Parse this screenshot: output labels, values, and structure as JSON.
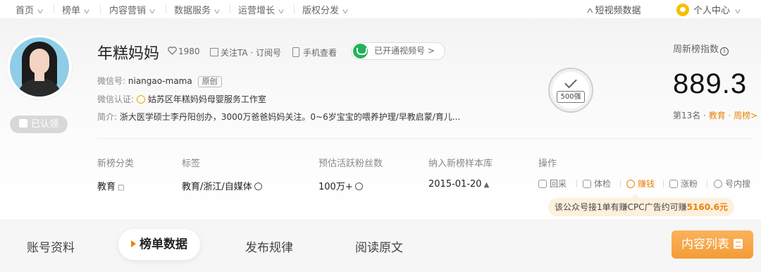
{
  "topnav": {
    "items": [
      {
        "label": "首页"
      },
      {
        "label": "榜单"
      },
      {
        "label": "内容营销"
      },
      {
        "label": "数据服务"
      },
      {
        "label": "运营增长"
      },
      {
        "label": "版权分发"
      }
    ],
    "short_video": "短视频数据",
    "personal_center": "个人中心"
  },
  "account": {
    "name": "年糕妈妈",
    "likes": "1980",
    "follow_label": "关注TA · 订阅号",
    "phone_label": "手机查看",
    "video_channel_label": "已开通视频号 >",
    "wechat_id_label": "微信号:",
    "wechat_id": "niangao-mama",
    "original_tag": "原创",
    "cert_label": "微信认证:",
    "cert_value": "姑苏区年糕妈妈母婴服务工作室",
    "intro_label": "简介:",
    "intro_value": "浙大医学硕士李丹阳创办，3000万爸爸妈妈关注。0~6岁宝宝的喂养护理/早教启蒙/育儿...",
    "claimed_label": "已认领"
  },
  "badge": {
    "label": "500强"
  },
  "index": {
    "title": "周新榜指数",
    "value": "889.3",
    "rank_prefix": "第13名 · ",
    "rank_link": "教育 · 周榜>"
  },
  "details": {
    "category_h": "新榜分类",
    "category_v": "教育",
    "tags_h": "标签",
    "tags_v": "教育/浙江/自媒体",
    "fans_h": "预估活跃粉丝数",
    "fans_v": "100万+",
    "since_h": "纳入新榜样本库",
    "since_v": "2015-01-20",
    "ops_h": "操作"
  },
  "ops": [
    {
      "label": "回采"
    },
    {
      "label": "体检"
    },
    {
      "label": "赚钱"
    },
    {
      "label": "涨粉"
    },
    {
      "label": "号内搜"
    }
  ],
  "earn_tip": {
    "text": "该公众号接1单有赚CPC广告约可赚",
    "amount": "5160.6元"
  },
  "tabs": {
    "t1": "账号资料",
    "t2": "榜单数据",
    "t3": "发布规律",
    "t4": "阅读原文",
    "content_list": "内容列表"
  },
  "colors": {
    "accent": "#e8830a",
    "video_green": "#21b35a"
  }
}
